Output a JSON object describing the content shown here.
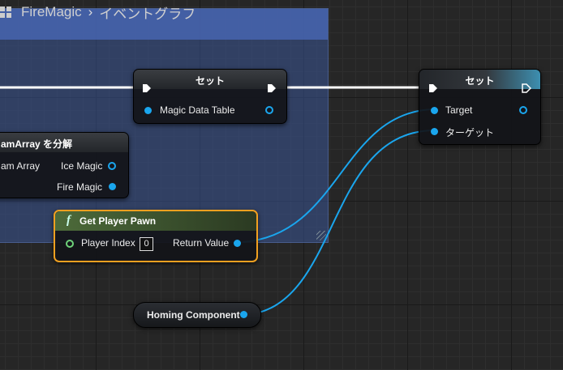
{
  "breadcrumb": {
    "blueprint": "FireMagic",
    "graph": "イベントグラフ"
  },
  "nodes": {
    "set1": {
      "title": "セット",
      "pin": "Magic Data Table"
    },
    "break": {
      "title": "amArray を分解",
      "in_pin": "am Array",
      "out1": "Ice Magic",
      "out2": "Fire Magic"
    },
    "get_pawn": {
      "title": "Get Player Pawn",
      "in_pin": "Player Index",
      "index_value": "0",
      "out_pin": "Return Value"
    },
    "set2": {
      "title": "セット",
      "pin1": "Target",
      "pin2": "ターゲット"
    },
    "homing": {
      "title": "Homing Component"
    }
  },
  "colors": {
    "object_pin": "#1aa6ee",
    "exec_wire": "#ffffff",
    "function_accent": "#f0a020"
  }
}
